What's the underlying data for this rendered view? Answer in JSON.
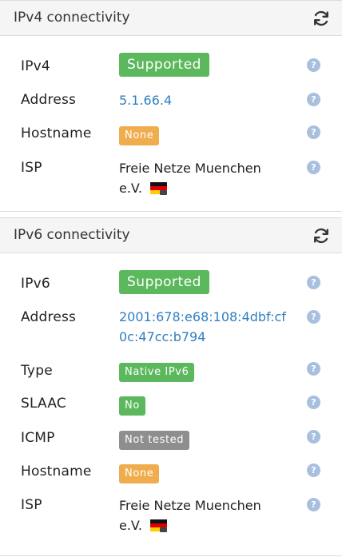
{
  "ipv4": {
    "title": "IPv4 connectivity",
    "rows": {
      "ipv4": {
        "label": "IPv4",
        "value": "Supported"
      },
      "address": {
        "label": "Address",
        "value": "5.1.66.4"
      },
      "hostname": {
        "label": "Hostname",
        "value": "None"
      },
      "isp": {
        "label": "ISP",
        "value_line1": "Freie Netze Muenchen",
        "value_line2": "e.V."
      }
    }
  },
  "ipv6": {
    "title": "IPv6 connectivity",
    "rows": {
      "ipv6": {
        "label": "IPv6",
        "value": "Supported"
      },
      "address": {
        "label": "Address",
        "value": "2001:678:e68:108:4dbf:cf0c:47cc:b794"
      },
      "type": {
        "label": "Type",
        "value": "Native IPv6"
      },
      "slaac": {
        "label": "SLAAC",
        "value": "No"
      },
      "icmp": {
        "label": "ICMP",
        "value": "Not tested"
      },
      "hostname": {
        "label": "Hostname",
        "value": "None"
      },
      "isp": {
        "label": "ISP",
        "value_line1": "Freie Netze Muenchen",
        "value_line2": "e.V."
      }
    }
  },
  "help_glyph": "?",
  "icons": {
    "refresh": "refresh-icon",
    "help": "question-circle-icon",
    "flag": "germany-flag-icon"
  },
  "colors": {
    "success": "#5cb85c",
    "warning": "#f0ad4e",
    "default": "#8e8e8e",
    "link": "#2f7fc1",
    "help": "#a8c0de",
    "heading_bg": "#f5f5f5"
  }
}
